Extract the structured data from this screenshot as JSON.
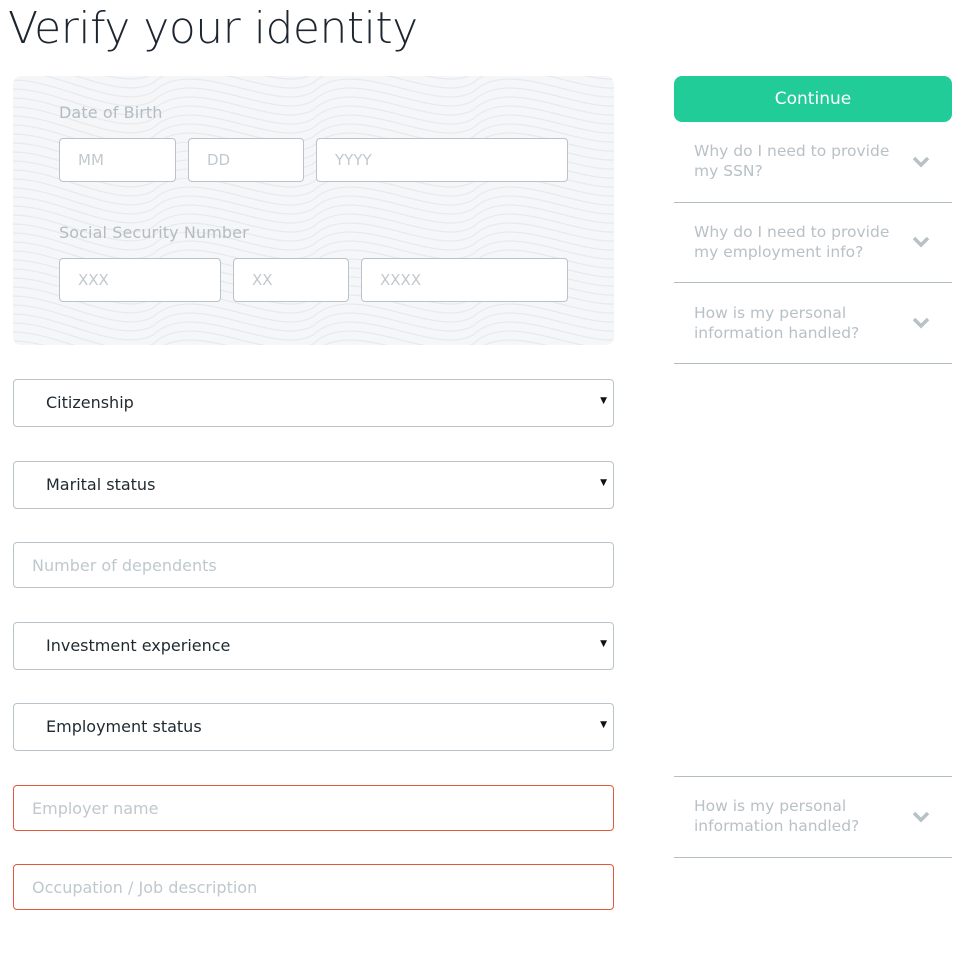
{
  "page": {
    "title": "Verify your identity"
  },
  "identity": {
    "dob_label": "Date of Birth",
    "dob_month_placeholder": "MM",
    "dob_day_placeholder": "DD",
    "dob_year_placeholder": "YYYY",
    "ssn_label": "Social Security Number",
    "ssn_part1_placeholder": "XXX",
    "ssn_part2_placeholder": "XX",
    "ssn_part3_placeholder": "XXXX"
  },
  "form": {
    "citizenship": "Citizenship",
    "marital_status": "Marital status",
    "dependents_placeholder": "Number of dependents",
    "investment_experience": "Investment experience",
    "employment_status": "Employment status",
    "employer_placeholder": "Employer name",
    "occupation_placeholder": "Occupation / Job description",
    "caret": "▼"
  },
  "sidebar": {
    "continue_label": "Continue",
    "faq": [
      {
        "question": "Why do I need to provide my SSN?"
      },
      {
        "question": "Why do I need to provide my employment info?"
      },
      {
        "question": "How is my personal information handled?"
      },
      {
        "question": "How is my personal information handled?"
      }
    ]
  },
  "colors": {
    "accent": "#22cc99",
    "error": "#e5573a",
    "border": "#b9c3c9",
    "muted_text": "#b8c1c6"
  }
}
